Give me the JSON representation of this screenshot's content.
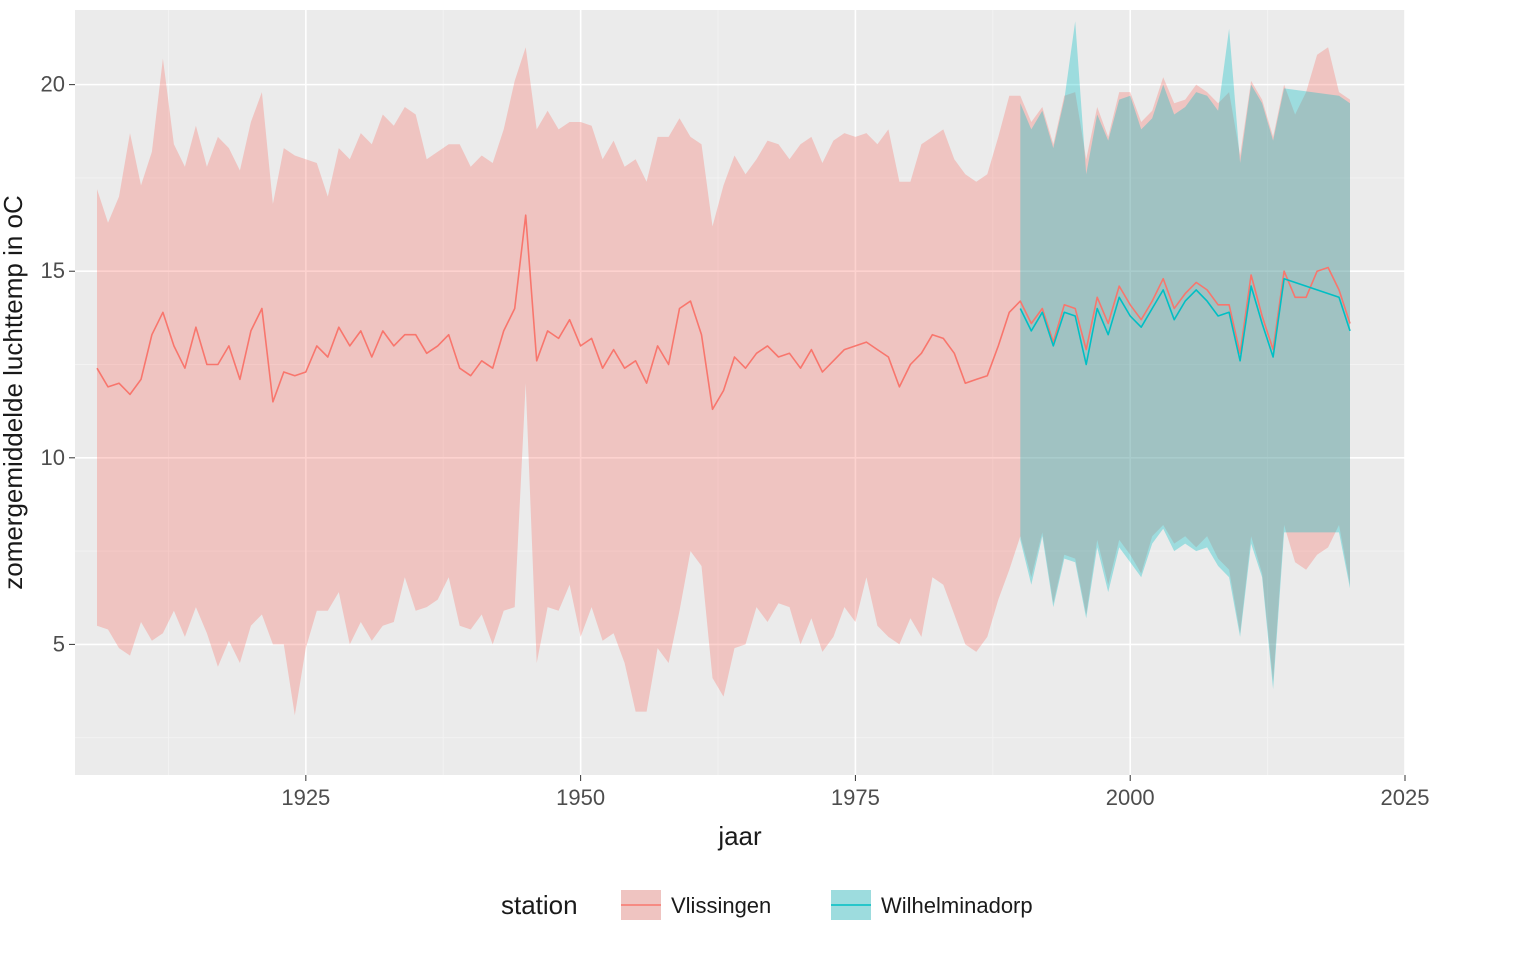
{
  "chart_data": {
    "type": "line",
    "xlabel": "jaar",
    "ylabel": "zomergemiddelde luchttemp in oC",
    "xlim": [
      1904,
      2025
    ],
    "ylim": [
      1.5,
      22
    ],
    "x_ticks": [
      1925,
      1950,
      1975,
      2000,
      2025
    ],
    "y_ticks": [
      5,
      10,
      15,
      20
    ],
    "legend_title": "station",
    "series": [
      {
        "name": "Vlissingen",
        "color": "#F8766D",
        "fill": "#F8766D",
        "fill_opacity": 0.33,
        "x": [
          1906,
          1907,
          1908,
          1909,
          1910,
          1911,
          1912,
          1913,
          1914,
          1915,
          1916,
          1917,
          1918,
          1919,
          1920,
          1921,
          1922,
          1923,
          1924,
          1925,
          1926,
          1927,
          1928,
          1929,
          1930,
          1931,
          1932,
          1933,
          1934,
          1935,
          1936,
          1937,
          1938,
          1939,
          1940,
          1941,
          1942,
          1943,
          1944,
          1945,
          1946,
          1947,
          1948,
          1949,
          1950,
          1951,
          1952,
          1953,
          1954,
          1955,
          1956,
          1957,
          1958,
          1959,
          1960,
          1961,
          1962,
          1963,
          1964,
          1965,
          1966,
          1967,
          1968,
          1969,
          1970,
          1971,
          1972,
          1973,
          1974,
          1975,
          1976,
          1977,
          1978,
          1979,
          1980,
          1981,
          1982,
          1983,
          1984,
          1985,
          1986,
          1987,
          1988,
          1989,
          1990,
          1991,
          1992,
          1993,
          1994,
          1995,
          1996,
          1997,
          1998,
          1999,
          2000,
          2001,
          2002,
          2003,
          2004,
          2005,
          2006,
          2007,
          2008,
          2009,
          2010,
          2011,
          2012,
          2013,
          2014,
          2015,
          2016,
          2017,
          2018,
          2019,
          2020
        ],
        "values": [
          12.4,
          11.9,
          12.0,
          11.7,
          12.1,
          13.3,
          13.9,
          13.0,
          12.4,
          13.5,
          12.5,
          12.5,
          13.0,
          12.1,
          13.4,
          14.0,
          11.5,
          12.3,
          12.2,
          12.3,
          13.0,
          12.7,
          13.5,
          13.0,
          13.4,
          12.7,
          13.4,
          13.0,
          13.3,
          13.3,
          12.8,
          13.0,
          13.3,
          12.4,
          12.2,
          12.6,
          12.4,
          13.4,
          14.0,
          16.5,
          12.6,
          13.4,
          13.2,
          13.7,
          13.0,
          13.2,
          12.4,
          12.9,
          12.4,
          12.6,
          12.0,
          13.0,
          12.5,
          14.0,
          14.2,
          13.3,
          11.3,
          11.8,
          12.7,
          12.4,
          12.8,
          13.0,
          12.7,
          12.8,
          12.4,
          12.9,
          12.3,
          12.6,
          12.9,
          13.0,
          13.1,
          12.9,
          12.7,
          11.9,
          12.5,
          12.8,
          13.3,
          13.2,
          12.8,
          12.0,
          12.1,
          12.2,
          13.0,
          13.9,
          14.2,
          13.6,
          14.0,
          13.1,
          14.1,
          14.0,
          12.9,
          14.3,
          13.6,
          14.6,
          14.1,
          13.7,
          14.2,
          14.8,
          14.0,
          14.4,
          14.7,
          14.5,
          14.1,
          14.1,
          12.8,
          14.9,
          13.8,
          12.9,
          15.0,
          14.3,
          14.3,
          15.0,
          15.1,
          14.5,
          13.6
        ],
        "upper": [
          17.2,
          16.3,
          17.0,
          18.7,
          17.3,
          18.2,
          20.7,
          18.4,
          17.8,
          18.9,
          17.8,
          18.6,
          18.3,
          17.7,
          19.0,
          19.8,
          16.8,
          18.3,
          18.1,
          18.0,
          17.9,
          17.0,
          18.3,
          18.0,
          18.7,
          18.4,
          19.2,
          18.9,
          19.4,
          19.2,
          18.0,
          18.2,
          18.4,
          18.4,
          17.8,
          18.1,
          17.9,
          18.8,
          20.1,
          21.0,
          18.8,
          19.3,
          18.8,
          19.0,
          19.0,
          18.9,
          18.0,
          18.5,
          17.8,
          18.0,
          17.4,
          18.6,
          18.6,
          19.1,
          18.6,
          18.4,
          16.2,
          17.3,
          18.1,
          17.6,
          18.0,
          18.5,
          18.4,
          18.0,
          18.4,
          18.6,
          17.9,
          18.5,
          18.7,
          18.6,
          18.7,
          18.4,
          18.8,
          17.4,
          17.4,
          18.4,
          18.6,
          18.8,
          18.0,
          17.6,
          17.4,
          17.6,
          18.6,
          19.7,
          19.7,
          19.0,
          19.4,
          18.4,
          19.7,
          19.8,
          18.0,
          19.4,
          18.6,
          19.8,
          19.8,
          19.0,
          19.3,
          20.2,
          19.5,
          19.6,
          20.0,
          19.8,
          19.5,
          19.8,
          18.1,
          20.1,
          19.6,
          18.6,
          20.0,
          19.2,
          19.8,
          20.8,
          21.0,
          19.8,
          19.6
        ],
        "lower": [
          5.5,
          5.4,
          4.9,
          4.7,
          5.6,
          5.1,
          5.3,
          5.9,
          5.2,
          6.0,
          5.3,
          4.4,
          5.1,
          4.5,
          5.5,
          5.8,
          5.0,
          5.0,
          3.1,
          4.9,
          5.9,
          5.9,
          6.4,
          5.0,
          5.6,
          5.1,
          5.5,
          5.6,
          6.8,
          5.9,
          6.0,
          6.2,
          6.8,
          5.5,
          5.4,
          5.8,
          5.0,
          5.9,
          6.0,
          12.0,
          4.5,
          6.0,
          5.9,
          6.6,
          5.2,
          6.0,
          5.1,
          5.3,
          4.5,
          3.2,
          3.2,
          4.9,
          4.5,
          5.9,
          7.5,
          7.1,
          4.1,
          3.6,
          4.9,
          5.0,
          6.0,
          5.6,
          6.1,
          6.0,
          5.0,
          5.7,
          4.8,
          5.2,
          6.0,
          5.6,
          6.8,
          5.5,
          5.2,
          5.0,
          5.7,
          5.2,
          6.8,
          6.6,
          5.8,
          5.0,
          4.8,
          5.2,
          6.2,
          7.0,
          7.9,
          6.8,
          8.0,
          6.1,
          7.4,
          7.3,
          5.8,
          7.8,
          6.6,
          7.8,
          7.4,
          6.9,
          7.9,
          8.2,
          7.7,
          7.9,
          7.6,
          7.9,
          7.3,
          7.0,
          5.3,
          7.9,
          6.9,
          4.0,
          8.2,
          7.2,
          7.0,
          7.4,
          7.6,
          8.2,
          6.6
        ]
      },
      {
        "name": "Wilhelminadorp",
        "color": "#00BFC4",
        "fill": "#00BFC4",
        "fill_opacity": 0.33,
        "x": [
          1990,
          1991,
          1992,
          1993,
          1994,
          1995,
          1996,
          1997,
          1998,
          1999,
          2000,
          2001,
          2002,
          2003,
          2004,
          2005,
          2006,
          2007,
          2008,
          2009,
          2010,
          2011,
          2012,
          2013,
          2014,
          2019,
          2020
        ],
        "values": [
          14.0,
          13.4,
          13.9,
          13.0,
          13.9,
          13.8,
          12.5,
          14.0,
          13.3,
          14.3,
          13.8,
          13.5,
          14.0,
          14.5,
          13.7,
          14.2,
          14.5,
          14.2,
          13.8,
          13.9,
          12.6,
          14.6,
          13.6,
          12.7,
          14.8,
          14.3,
          13.4
        ],
        "upper": [
          19.5,
          18.8,
          19.3,
          18.3,
          19.6,
          21.7,
          17.6,
          19.2,
          18.5,
          19.6,
          19.7,
          18.8,
          19.1,
          20.0,
          19.2,
          19.4,
          19.8,
          19.7,
          19.3,
          21.5,
          17.9,
          20.0,
          19.5,
          18.5,
          19.9,
          19.7,
          19.5
        ],
        "lower": [
          7.8,
          6.6,
          7.9,
          6.0,
          7.3,
          7.2,
          5.7,
          7.6,
          6.4,
          7.6,
          7.2,
          6.8,
          7.7,
          8.1,
          7.5,
          7.7,
          7.5,
          7.6,
          7.1,
          6.8,
          5.2,
          7.7,
          6.8,
          3.8,
          8.0,
          8.0,
          6.5
        ]
      }
    ]
  }
}
